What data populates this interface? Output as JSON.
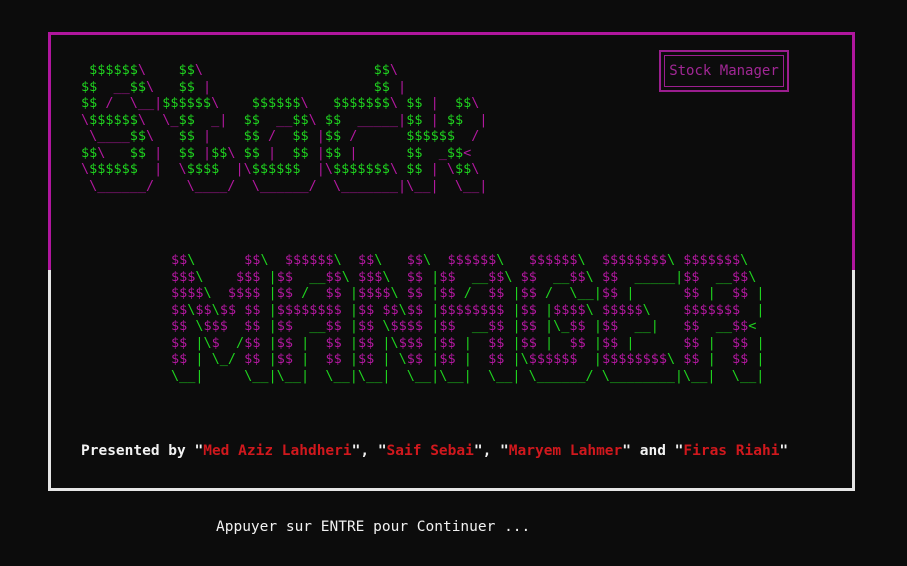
{
  "window": {
    "title_box": "Stock Manager"
  },
  "ascii_art": {
    "stock_lines": [
      " $$$$$$\\    $$\\                     $$\\",
      "$$  __$$\\   $$ |                    $$ |",
      "$$ /  \\__|$$$$$$\\    $$$$$$\\   $$$$$$$\\ $$ |  $$\\",
      "\\$$$$$$\\  \\_$$  _|  $$  __$$\\ $$  _____|$$ | $$  |",
      " \\____$$\\   $$ |    $$ /  $$ |$$ /      $$$$$$  /",
      "$$\\   $$ |  $$ |$$\\ $$ |  $$ |$$ |      $$  _$$<",
      "\\$$$$$$  |  \\$$$$  |\\$$$$$$  |\\$$$$$$$\\ $$ | \\$$\\",
      " \\______/    \\____/  \\______/  \\_______|\\__|  \\__|"
    ],
    "manager_lines": [
      "$$\\      $$\\  $$$$$$\\  $$\\   $$\\  $$$$$$\\   $$$$$$\\  $$$$$$$$\\ $$$$$$$\\",
      "$$$\\    $$$ |$$  __$$\\ $$$\\  $$ |$$  __$$\\ $$  __$$\\ $$  _____|$$  __$$\\",
      "$$$$\\  $$$$ |$$ /  $$ |$$$$\\ $$ |$$ /  $$ |$$ /  \\__|$$ |      $$ |  $$ |",
      "$$\\$$\\$$ $$ |$$$$$$$$ |$$ $$\\$$ |$$$$$$$$ |$$ |$$$$\\ $$$$$\\    $$$$$$$  |",
      "$$ \\$$$  $$ |$$  __$$ |$$ \\$$$$ |$$  __$$ |$$ |\\_$$ |$$  __|   $$  __$$<",
      "$$ |\\$  /$$ |$$ |  $$ |$$ |\\$$$ |$$ |  $$ |$$ |  $$ |$$ |      $$ |  $$ |",
      "$$ | \\_/ $$ |$$ |  $$ |$$ | \\$$ |$$ |  $$ |\\$$$$$$  |$$$$$$$$\\ $$ |  $$ |",
      "\\__|     \\__|\\__|  \\__|\\__|  \\__|\\__|  \\__| \\______/ \\________|\\__|  \\__|"
    ]
  },
  "credits": {
    "prefix": "Presented by \"",
    "name1": "Med Aziz Lahdheri",
    "sep1": "\", \"",
    "name2": "Saif Sebai",
    "sep2": "\", \"",
    "name3": "Maryem Lahmer",
    "sep3": "\" and \"",
    "name4": "Firas Riahi",
    "suffix": "\""
  },
  "prompt": {
    "continue_text": "Appuyer sur ENTRE pour Continuer ..."
  },
  "colors": {
    "background": "#0c0c0c",
    "magenta_border": "#b0169e",
    "white_border": "#e6e6e6",
    "green": "#1fd21f",
    "magenta": "#b2189f",
    "red": "#d0181d",
    "text": "#f2f2f2"
  }
}
